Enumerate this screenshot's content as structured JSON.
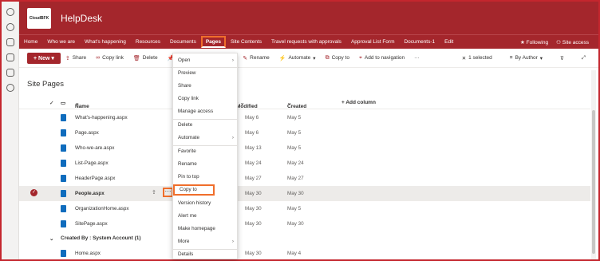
{
  "site": {
    "logo_text": "CloudBFK",
    "title": "HelpDesk"
  },
  "nav": {
    "items": [
      "Home",
      "Who we are",
      "What's happening",
      "Resources",
      "Documents",
      "Pages",
      "Site Contents",
      "Travel requests with approvals",
      "Approval List Form",
      "Documents-1",
      "Edit"
    ],
    "following": "Following",
    "site_access": "Site access"
  },
  "cmd": {
    "new": "New",
    "share": "Share",
    "copy_link": "Copy link",
    "delete": "Delete",
    "rename": "Rename",
    "automate": "Automate",
    "copy_to": "Copy to",
    "add_nav": "Add to navigation",
    "more": "···",
    "selected": "1 selected",
    "by_author": "By Author"
  },
  "page_title": "Site Pages",
  "columns": {
    "name": "Name",
    "modified": "Modified",
    "created": "Created",
    "add": "+ Add column"
  },
  "rows": [
    {
      "name": "What's-happening.aspx",
      "modified": "May 6",
      "created": "May 5"
    },
    {
      "name": "Page.aspx",
      "modified": "May 6",
      "created": "May 5"
    },
    {
      "name": "Who-we-are.aspx",
      "modified": "May 13",
      "created": "May 5"
    },
    {
      "name": "List-Page.aspx",
      "modified": "May 24",
      "created": "May 24"
    },
    {
      "name": "HeaderPage.aspx",
      "modified": "May 27",
      "created": "May 27"
    },
    {
      "name": "People.aspx",
      "modified": "May 30",
      "created": "May 30"
    },
    {
      "name": "OrganizationHome.aspx",
      "modified": "May 30",
      "created": "May 5"
    },
    {
      "name": "SitePage.aspx",
      "modified": "May 30",
      "created": "May 30"
    }
  ],
  "group": {
    "label": "Created By : System Account (1)"
  },
  "group_row": {
    "name": "Home.aspx",
    "modified": "May 30",
    "created": "May 4"
  },
  "menu": [
    "Open",
    "Preview",
    "Share",
    "Copy link",
    "Manage access",
    "Delete",
    "Automate",
    "Favorite",
    "Rename",
    "Pin to top",
    "Copy to",
    "Version history",
    "Alert me",
    "Make homepage",
    "More",
    "Details"
  ],
  "colors": {
    "brand": "#a4262c",
    "highlight": "#f06e2b"
  }
}
